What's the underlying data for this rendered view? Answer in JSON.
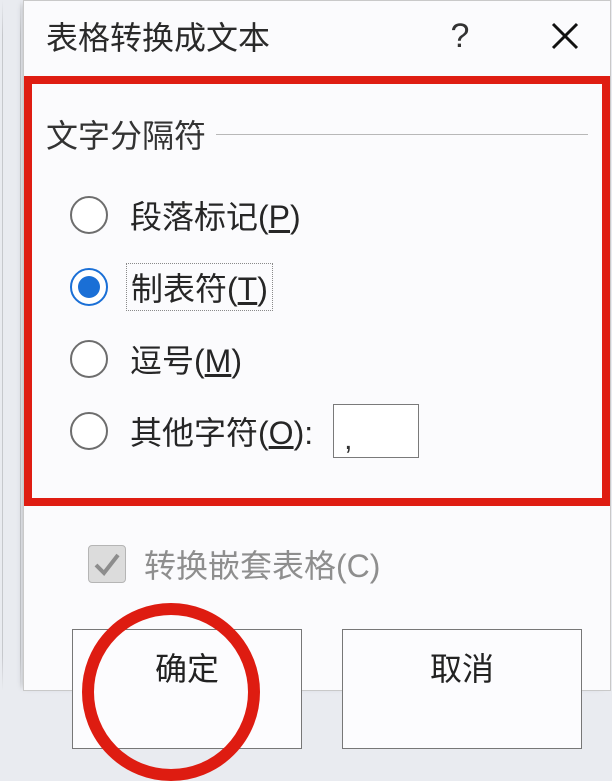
{
  "dialog": {
    "title": "表格转换成文本",
    "help_symbol": "?",
    "close_alt": "close"
  },
  "section": {
    "heading": "文字分隔符"
  },
  "options": {
    "paragraph": {
      "label_pre": "段落标记(",
      "accel": "P",
      "label_post": ")"
    },
    "tab": {
      "label_pre": "制表符(",
      "accel": "T",
      "label_post": ")"
    },
    "comma": {
      "label_pre": "逗号(",
      "accel": "M",
      "label_post": ")"
    },
    "other": {
      "label_pre": "其他字符(",
      "accel": "O",
      "label_post": "):",
      "value": ","
    }
  },
  "checkbox": {
    "label": "转换嵌套表格(C)"
  },
  "buttons": {
    "ok": "确定",
    "cancel": "取消"
  }
}
